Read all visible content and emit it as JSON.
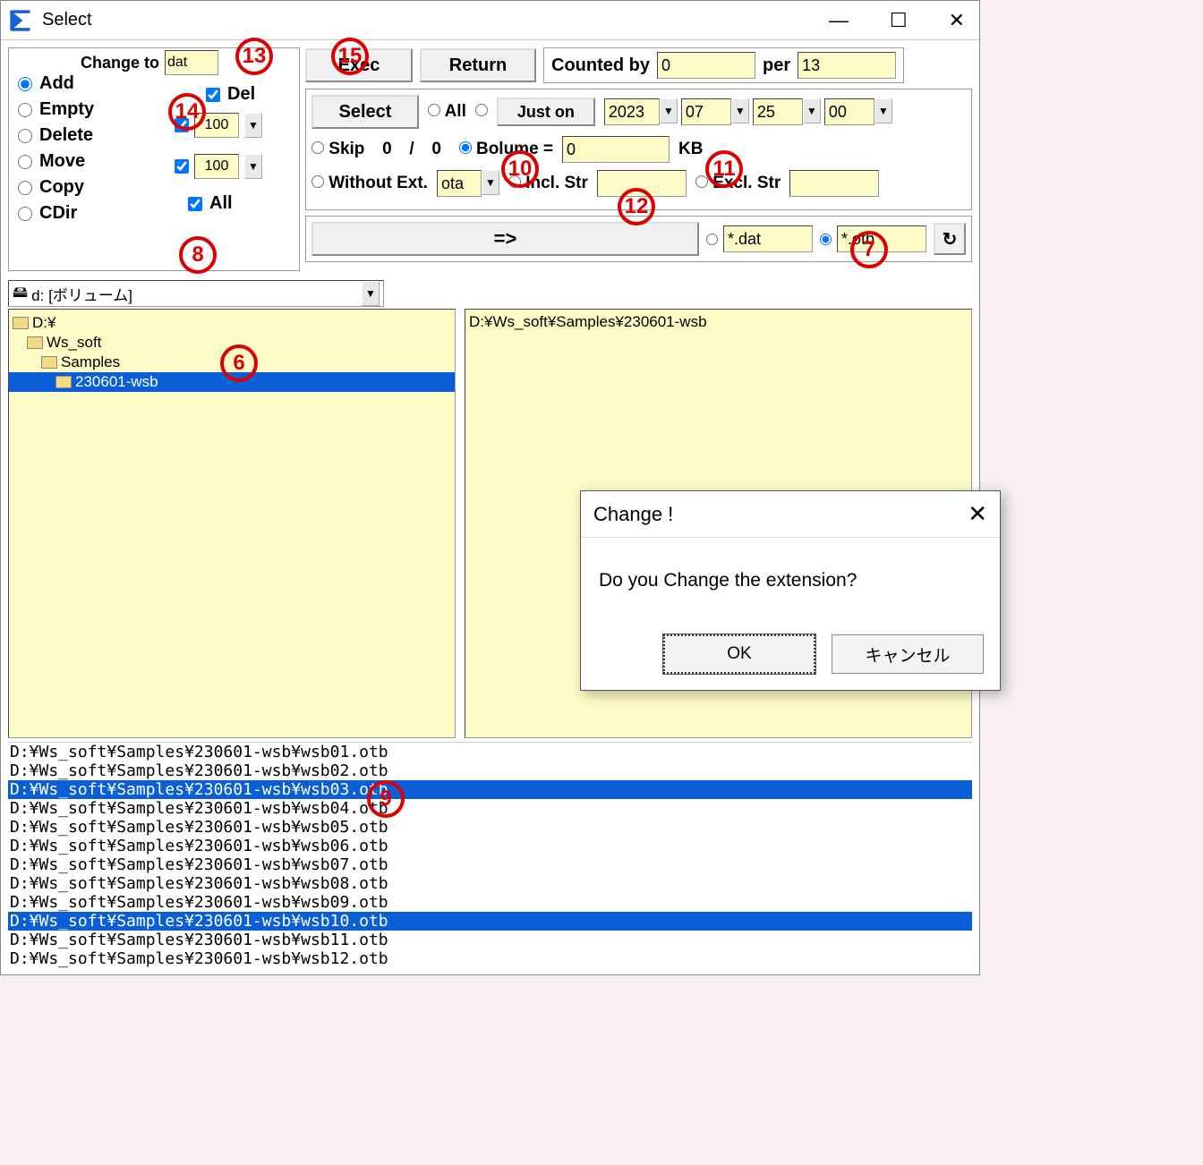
{
  "window": {
    "title": "Select"
  },
  "changeTo": {
    "label": "Change to",
    "value": "dat"
  },
  "actions": {
    "add": "Add",
    "empty": "Empty",
    "delete": "Delete",
    "move": "Move",
    "copy": "Copy",
    "cdir": "CDir",
    "del": "Del",
    "all": "All",
    "spin1": "100",
    "spin2": "100"
  },
  "topbtns": {
    "exec": "Exec",
    "return": "Return"
  },
  "count": {
    "label": "Counted by",
    "value": "0",
    "perLabel": "per",
    "perValue": "13"
  },
  "select": {
    "btn": "Select",
    "all": "All",
    "juston": "Just on",
    "year": "2023",
    "month": "07",
    "day": "25",
    "hour": "00",
    "skip": "Skip",
    "skipA": "0",
    "skipB": "0",
    "bolume": "Bolume =",
    "bolumeVal": "0",
    "kb": "KB",
    "without": "Without Ext.",
    "withoutVal": "ota",
    "incl": "Incl. Str",
    "excl": "Excl. Str"
  },
  "arrow": "=>",
  "ext": {
    "a": "*.dat",
    "b": "*.otb"
  },
  "drive": "d: [ボリューム]",
  "tree": [
    "D:¥",
    "Ws_soft",
    "Samples",
    "230601-wsb"
  ],
  "pathBox": "D:¥Ws_soft¥Samples¥230601-wsb",
  "files": [
    "D:¥Ws_soft¥Samples¥230601-wsb¥wsb01.otb",
    "D:¥Ws_soft¥Samples¥230601-wsb¥wsb02.otb",
    "D:¥Ws_soft¥Samples¥230601-wsb¥wsb03.otb",
    "D:¥Ws_soft¥Samples¥230601-wsb¥wsb04.otb",
    "D:¥Ws_soft¥Samples¥230601-wsb¥wsb05.otb",
    "D:¥Ws_soft¥Samples¥230601-wsb¥wsb06.otb",
    "D:¥Ws_soft¥Samples¥230601-wsb¥wsb07.otb",
    "D:¥Ws_soft¥Samples¥230601-wsb¥wsb08.otb",
    "D:¥Ws_soft¥Samples¥230601-wsb¥wsb09.otb",
    "D:¥Ws_soft¥Samples¥230601-wsb¥wsb10.otb",
    "D:¥Ws_soft¥Samples¥230601-wsb¥wsb11.otb",
    "D:¥Ws_soft¥Samples¥230601-wsb¥wsb12.otb"
  ],
  "fileSel": [
    2,
    9
  ],
  "dialog": {
    "title": "Change !",
    "msg": "Do you Change the extension?",
    "ok": "OK",
    "cancel": "キャンセル"
  },
  "badges": {
    "6": "6",
    "7": "7",
    "8": "8",
    "9": "9",
    "10": "10",
    "11": "11",
    "12": "12",
    "13": "13",
    "14": "14",
    "15": "15"
  }
}
